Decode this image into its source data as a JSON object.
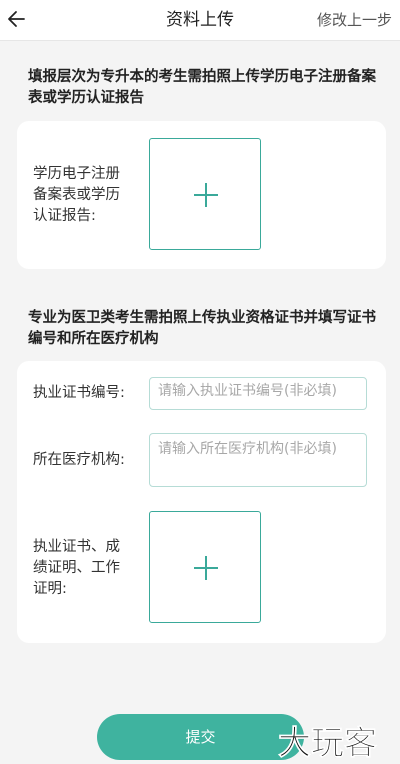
{
  "header": {
    "title": "资料上传",
    "modify_label": "修改上一步"
  },
  "section1": {
    "title": "填报层次为专升本的考生需拍照上传学历电子注册备案表或学历认证报告",
    "upload_label_line1": "学历电子注册",
    "upload_label_line2": "备案表或学历",
    "upload_label_line3": "认证报告:"
  },
  "section2": {
    "title": "专业为医卫类考生需拍照上传执业资格证书并填写证书编号和所在医疗机构",
    "cert_number_label": "执业证书编号:",
    "cert_number_placeholder": "请输入执业证书编号(非必填)",
    "institution_label": "所在医疗机构:",
    "institution_placeholder": "请输入所在医疗机构(非必填)",
    "upload_label_line1": "执业证书、成",
    "upload_label_line2": "绩证明、工作",
    "upload_label_line3": "证明:"
  },
  "submit_label": "提交",
  "logo_text": "大玩客",
  "colors": {
    "accent": "#3fb39f",
    "border_accent": "#3aa99a",
    "background": "#f4f4f4"
  }
}
